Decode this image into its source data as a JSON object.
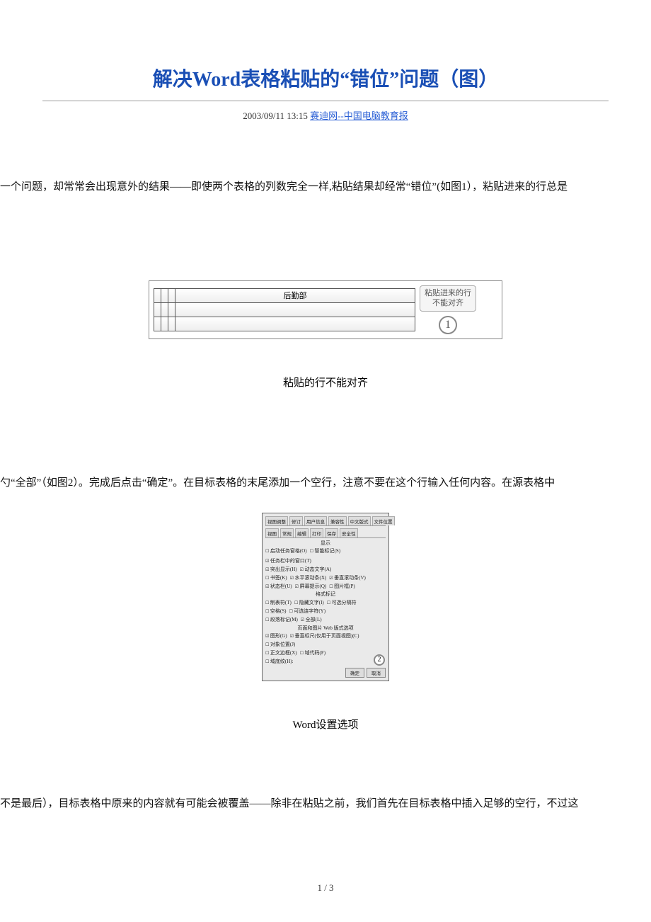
{
  "title": "解决Word表格粘贴的“错位”问题（图）",
  "meta": {
    "datetime": "2003/09/11 13:15",
    "source": "赛迪网--中国电脑教育报"
  },
  "paragraphs": {
    "p1": "一个问题，却常常会出现意外的结果——即使两个表格的列数完全一样,粘贴结果却经常“错位”(如图1），粘贴进来的行总是",
    "p2": "勺“全部”（如图2）。完成后点击“确定”。在目标表格的末尾添加一个空行，注意不要在这个行输入任何内容。在源表格中",
    "p3": "不是最后），目标表格中原来的内容就有可能会被覆盖——除非在粘贴之前，我们首先在目标表格中插入足够的空行，不过这"
  },
  "figure1": {
    "header_cell": "后勤部",
    "callout_line1": "粘贴进来的行",
    "callout_line2": "不能对齐",
    "badge": "1",
    "caption": "粘贴的行不能对齐"
  },
  "figure2": {
    "tabs": [
      "视图调整",
      "修订",
      "用户信息",
      "兼容性",
      "中文版式",
      "文件位置"
    ],
    "tabs2": [
      "视图",
      "常规",
      "编辑",
      "打印",
      "保存",
      "安全性"
    ],
    "section_show": "显示",
    "opts_row1": [
      "启动任务窗格(O)",
      "智能标记(S)",
      "任务栏中的窗口(T)"
    ],
    "opts_row2": [
      "突出显示(H)",
      "动态文字(A)"
    ],
    "opts_row3": [
      "书签(K)",
      "水平滚动条(X)",
      "垂直滚动条(V)"
    ],
    "opts_row4": [
      "状态栏(U)",
      "屏幕提示(Q)",
      "图片框(P)"
    ],
    "section_fmt": "格式标记",
    "fmt_row1": [
      "制表符(T)",
      "隐藏文字(I)",
      "可选分隔符"
    ],
    "fmt_row2": [
      "空格(S)",
      "可选连字符(Y)"
    ],
    "fmt_row3": [
      "段落标记(M)",
      "全部(L)"
    ],
    "section_layout": "页面和图片 Web 版式选项",
    "layout_row1": [
      "图形(G)",
      "垂直标尺(仅用于页面视图)(C)"
    ],
    "layout_row2": [
      "对象位置(J)"
    ],
    "layout_row3": [
      "正文边框(X)",
      "域代码(F)"
    ],
    "layout_row4": [
      "域底纹(H):"
    ],
    "btn_ok": "确定",
    "btn_cancel": "取消",
    "badge": "2",
    "caption": "Word设置选项"
  },
  "page_number": "1 / 3"
}
